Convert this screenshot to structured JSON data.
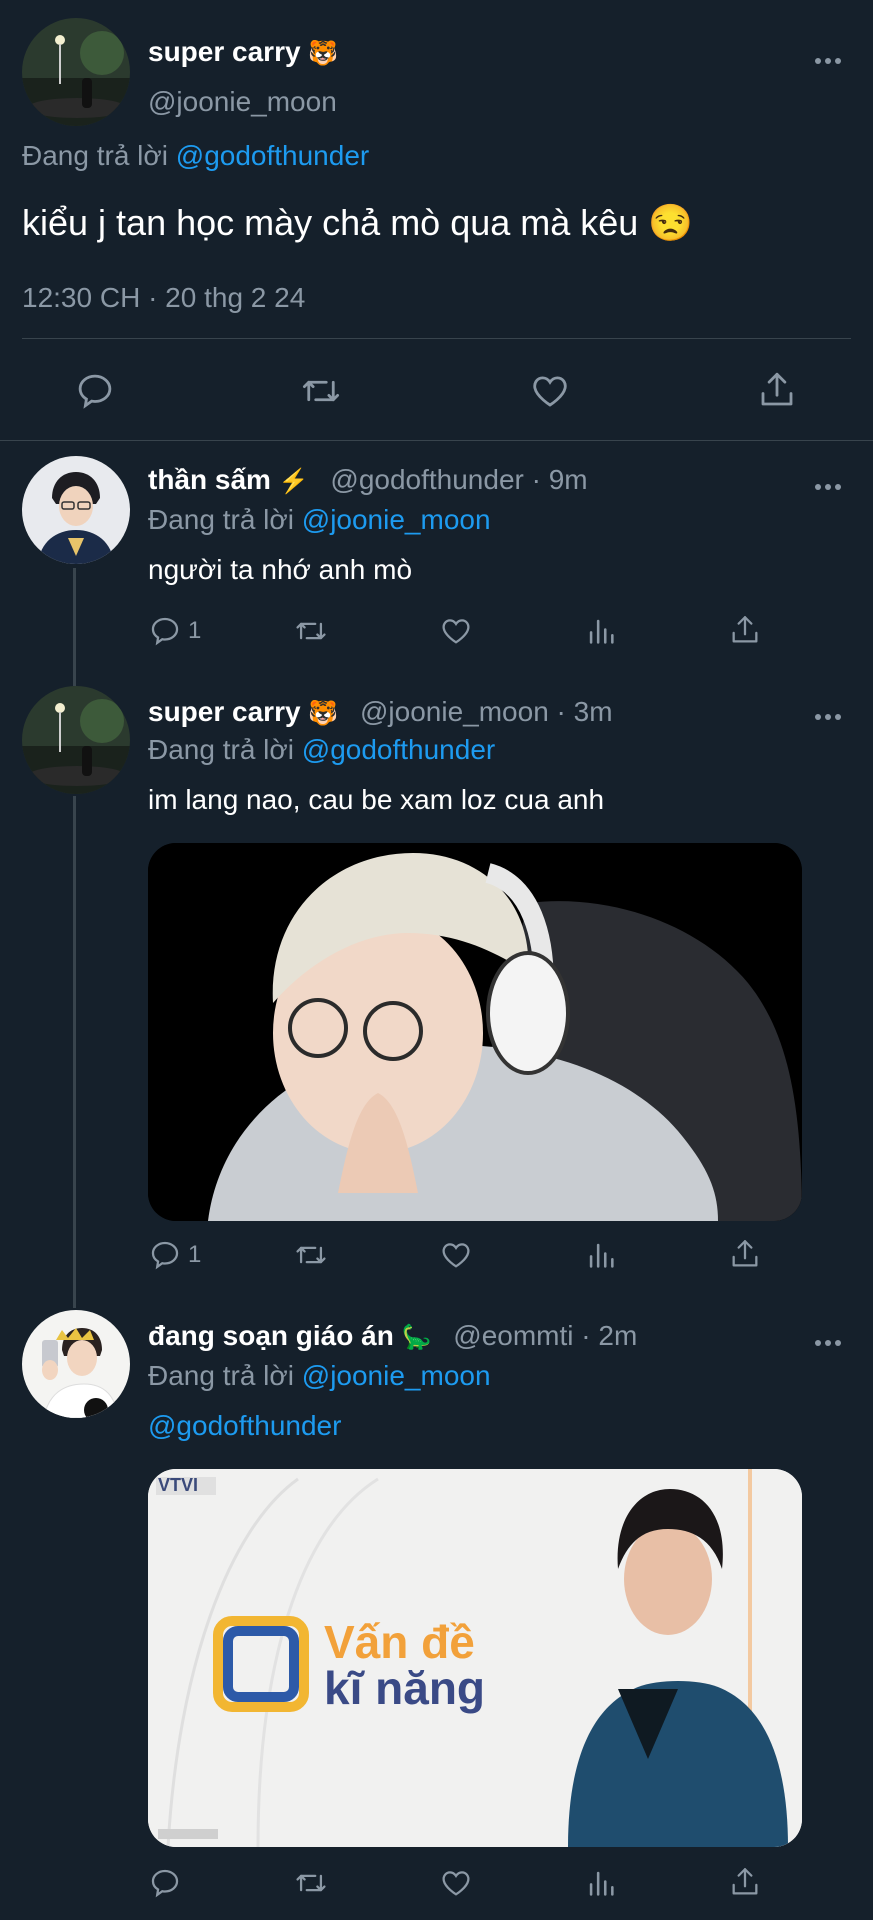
{
  "main_tweet": {
    "display_name": "super carry",
    "emoji": "🐯",
    "handle": "@joonie_moon",
    "reply_prefix": "Đang trả lời",
    "reply_to": "@godofthunder",
    "text": "kiểu j tan học mày chả mò qua mà kêu 😒",
    "timestamp": "12:30 CH · 20 thg 2 24"
  },
  "replies": [
    {
      "display_name": "thần sấm",
      "emoji": "⚡",
      "handle_time": "@godofthunder · 9m",
      "reply_prefix": "Đang trả lời",
      "reply_to": "@joonie_moon",
      "text": "người ta nhớ anh mò",
      "reply_count": "1"
    },
    {
      "display_name": "super carry",
      "emoji": "🐯",
      "handle_time": "@joonie_moon · 3m",
      "reply_prefix": "Đang trả lời",
      "reply_to": "@godofthunder",
      "text": "im lang nao, cau be xam loz cua anh",
      "reply_count": "1"
    },
    {
      "display_name": "đang soạn giáo án",
      "emoji": "🦕",
      "handle_time": "@eommti · 2m",
      "reply_prefix": "Đang trả lời",
      "reply_to": "@joonie_moon",
      "text": "@godofthunder",
      "reply_count": "",
      "media_text": {
        "channel": "VTVI",
        "line1": "Vấn đề",
        "line2": "kĩ năng"
      }
    }
  ],
  "colors": {
    "background": "#15202b",
    "accent": "#1d9bf0",
    "muted": "#8b98a5",
    "divider": "#38444d"
  }
}
